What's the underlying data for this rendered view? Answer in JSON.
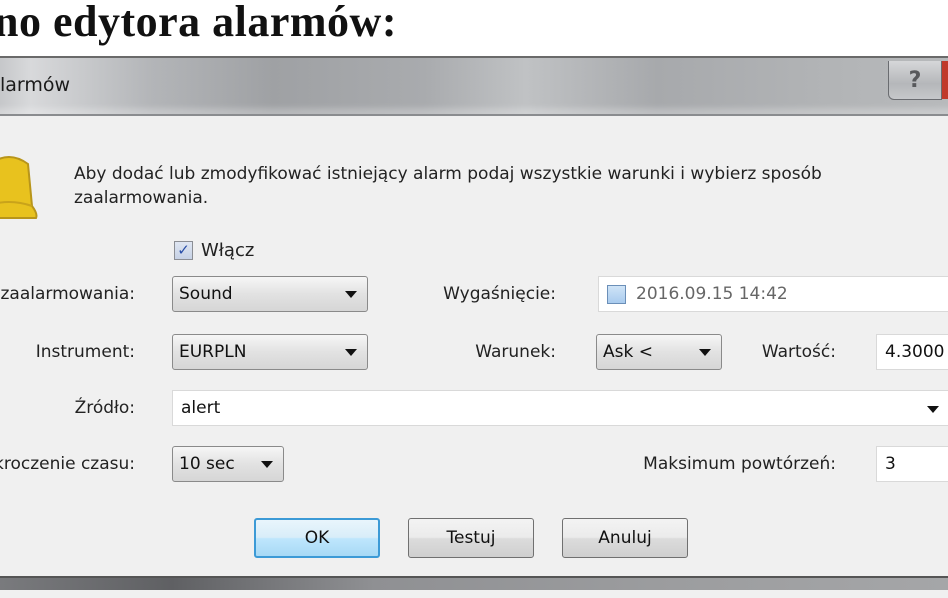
{
  "heading": "no edytora alarmów:",
  "window": {
    "title": "larmów",
    "help_glyph": "?"
  },
  "dialog": {
    "description": "Aby dodać lub zmodyfikować istniejący alarm podaj wszystkie warunki i wybierz sposób zaalarmowania.",
    "enable": {
      "label": "Włącz",
      "checked": true,
      "glyph": "✓"
    },
    "fields": {
      "alert_method": {
        "label": "b zaalarmowania:",
        "value": "Sound"
      },
      "expiry": {
        "label": "Wygaśnięcie:",
        "checked": false,
        "value": "2016.09.15 14:42"
      },
      "instrument": {
        "label": "Instrument:",
        "value": "EURPLN"
      },
      "condition": {
        "label": "Warunek:",
        "value": "Ask <"
      },
      "value": {
        "label": "Wartość:",
        "value": "4.3000"
      },
      "source": {
        "label": "Źródło:",
        "value": "alert"
      },
      "timeout": {
        "label": "ekroczenie czasu:",
        "value": "10 sec"
      },
      "max_repeats": {
        "label": "Maksimum powtórzeń:",
        "value": "3"
      }
    },
    "buttons": {
      "ok": "OK",
      "test": "Testuj",
      "cancel": "Anuluj"
    }
  },
  "colors": {
    "bell": "#e8c21e",
    "primary_button_border": "#3c9ad6",
    "dialog_bg": "#f0f0f0"
  }
}
